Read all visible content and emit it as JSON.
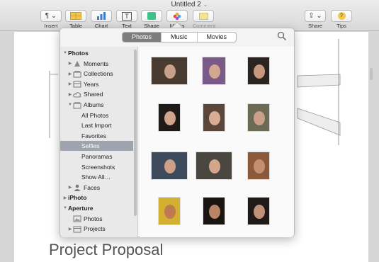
{
  "window": {
    "title": "Untitled 2"
  },
  "toolbar": {
    "buttons": [
      {
        "label": "Insert"
      },
      {
        "label": "Table"
      },
      {
        "label": "Chart"
      },
      {
        "label": "Text"
      },
      {
        "label": "Shape"
      },
      {
        "label": "Media"
      },
      {
        "label": "Comment"
      },
      {
        "label": "Share"
      },
      {
        "label": "Tips"
      }
    ]
  },
  "document": {
    "title": "Project Proposal"
  },
  "popover": {
    "tabs": [
      {
        "label": "Photos",
        "active": true
      },
      {
        "label": "Music",
        "active": false
      },
      {
        "label": "Movies",
        "active": false
      }
    ],
    "sidebar": [
      {
        "label": "Photos",
        "level": 0,
        "expand": "down",
        "icon": ""
      },
      {
        "label": "Moments",
        "level": 1,
        "expand": "right",
        "icon": "moments-icon"
      },
      {
        "label": "Collections",
        "level": 1,
        "expand": "right",
        "icon": "collections-icon"
      },
      {
        "label": "Years",
        "level": 1,
        "expand": "right",
        "icon": "years-icon"
      },
      {
        "label": "Shared",
        "level": 1,
        "expand": "right",
        "icon": "cloud-icon"
      },
      {
        "label": "Albums",
        "level": 1,
        "expand": "down",
        "icon": "albums-icon"
      },
      {
        "label": "All Photos",
        "level": 2,
        "expand": "",
        "icon": ""
      },
      {
        "label": "Last Import",
        "level": 2,
        "expand": "",
        "icon": ""
      },
      {
        "label": "Favorites",
        "level": 2,
        "expand": "",
        "icon": ""
      },
      {
        "label": "Selfies",
        "level": 2,
        "expand": "",
        "icon": "",
        "selected": true
      },
      {
        "label": "Panoramas",
        "level": 2,
        "expand": "",
        "icon": ""
      },
      {
        "label": "Screenshots",
        "level": 2,
        "expand": "",
        "icon": ""
      },
      {
        "label": "Show All…",
        "level": 2,
        "expand": "",
        "icon": ""
      },
      {
        "label": "Faces",
        "level": 1,
        "expand": "right",
        "icon": "faces-icon"
      },
      {
        "label": "iPhoto",
        "level": 0,
        "expand": "right",
        "icon": ""
      },
      {
        "label": "Aperture",
        "level": 0,
        "expand": "down",
        "icon": ""
      },
      {
        "label": "Photos",
        "level": 1,
        "expand": "",
        "icon": "photos-icon"
      },
      {
        "label": "Projects",
        "level": 1,
        "expand": "right",
        "icon": "projects-icon"
      }
    ],
    "thumbnails": [
      {
        "name": "selfie-1",
        "color": "#4a3b30",
        "face": "#c9a08a"
      },
      {
        "name": "selfie-2",
        "color": "#7a5a86",
        "face": "#d2a88f"
      },
      {
        "name": "selfie-3",
        "color": "#2c2420",
        "face": "#c8987e"
      },
      {
        "name": "selfie-4",
        "color": "#1e1a18",
        "face": "#d0a58c"
      },
      {
        "name": "selfie-5",
        "color": "#5a463a",
        "face": "#d9ad94"
      },
      {
        "name": "selfie-6",
        "color": "#6b6a55",
        "face": "#caa088"
      },
      {
        "name": "selfie-7",
        "color": "#3d4a5c",
        "face": "#cc9f86"
      },
      {
        "name": "selfie-8",
        "color": "#4a4640",
        "face": "#d3a58b"
      },
      {
        "name": "selfie-9",
        "color": "#8a5a3a",
        "face": "#c48e73"
      },
      {
        "name": "selfie-10",
        "color": "#d4b030",
        "face": "#c07a52"
      },
      {
        "name": "selfie-11",
        "color": "#1a1410",
        "face": "#b88468"
      },
      {
        "name": "selfie-12",
        "color": "#1f1a17",
        "face": "#c09078"
      }
    ]
  }
}
